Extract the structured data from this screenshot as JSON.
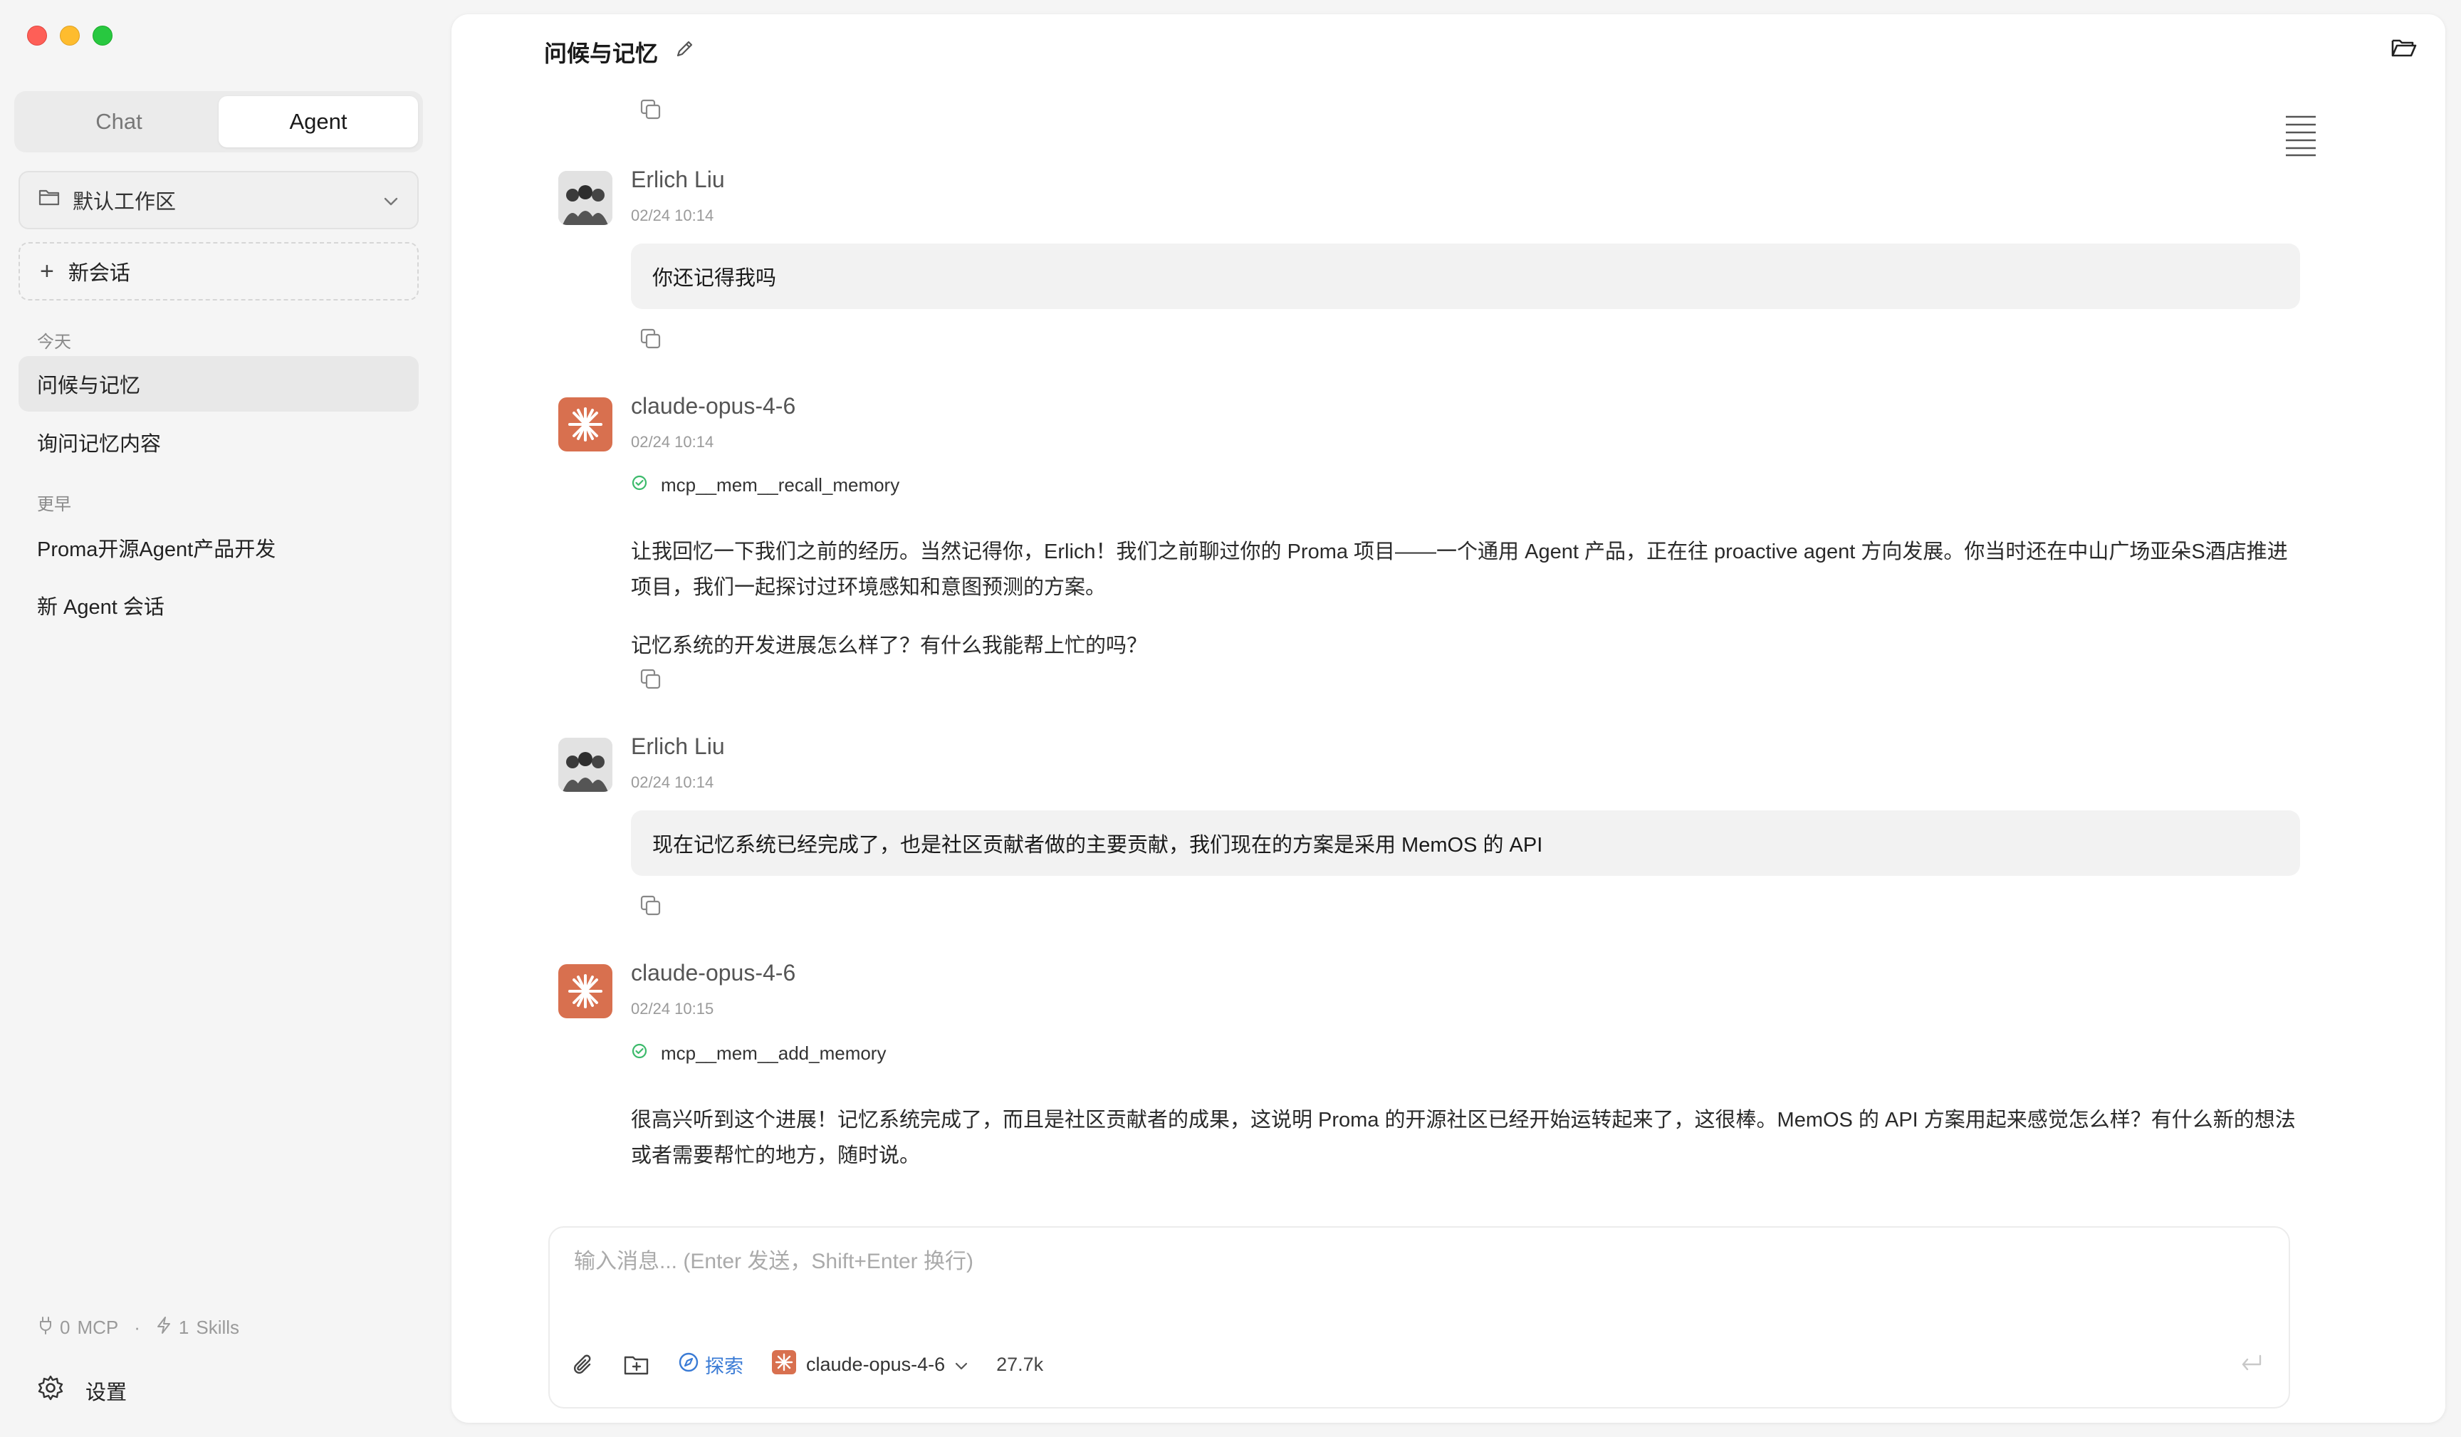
{
  "sidebar": {
    "mode_tabs": [
      {
        "label": "Chat",
        "active": false
      },
      {
        "label": "Agent",
        "active": true
      }
    ],
    "workspace": {
      "label": "默认工作区"
    },
    "new_chat_label": "新会话",
    "groups": [
      {
        "label": "今天",
        "items": [
          {
            "label": "问候与记忆",
            "active": true
          },
          {
            "label": "询问记忆内容",
            "active": false
          }
        ]
      },
      {
        "label": "更早",
        "items": [
          {
            "label": "Proma开源Agent产品开发",
            "active": false
          },
          {
            "label": "新 Agent 会话",
            "active": false
          }
        ]
      }
    ],
    "footer": {
      "mcp_count": "0",
      "mcp_label": "MCP",
      "separator": "·",
      "skills_count": "1",
      "skills_label": "Skills"
    },
    "settings_label": "设置"
  },
  "header": {
    "title": "问候与记忆"
  },
  "messages": [
    {
      "role": "user",
      "name": "Erlich Liu",
      "time": "02/24 10:14",
      "text": "你还记得我吗"
    },
    {
      "role": "assistant",
      "name": "claude-opus-4-6",
      "time": "02/24 10:14",
      "tool": "mcp__mem__recall_memory",
      "paragraphs": [
        "让我回忆一下我们之前的经历。当然记得你，Erlich！我们之前聊过你的 Proma 项目——一个通用 Agent 产品，正在往 proactive agent 方向发展。你当时还在中山广场亚朵S酒店推进项目，我们一起探讨过环境感知和意图预测的方案。",
        "记忆系统的开发进展怎么样了？有什么我能帮上忙的吗？"
      ]
    },
    {
      "role": "user",
      "name": "Erlich Liu",
      "time": "02/24 10:14",
      "text": "现在记忆系统已经完成了，也是社区贡献者做的主要贡献，我们现在的方案是采用 MemOS 的 API"
    },
    {
      "role": "assistant",
      "name": "claude-opus-4-6",
      "time": "02/24 10:15",
      "tool": "mcp__mem__add_memory",
      "paragraphs": [
        "很高兴听到这个进展！记忆系统完成了，而且是社区贡献者的成果，这说明 Proma 的开源社区已经开始运转起来了，这很棒。MemOS 的 API 方案用起来感觉怎么样？有什么新的想法或者需要帮忙的地方，随时说。"
      ]
    }
  ],
  "composer": {
    "placeholder": "输入消息... (Enter 发送，Shift+Enter 换行)",
    "explore_label": "探索",
    "model_label": "claude-opus-4-6",
    "token_count": "27.7k"
  },
  "colors": {
    "accent_blue": "#3a7bd5",
    "claude_orange": "#d8704f",
    "success_green": "#3cba6b"
  }
}
